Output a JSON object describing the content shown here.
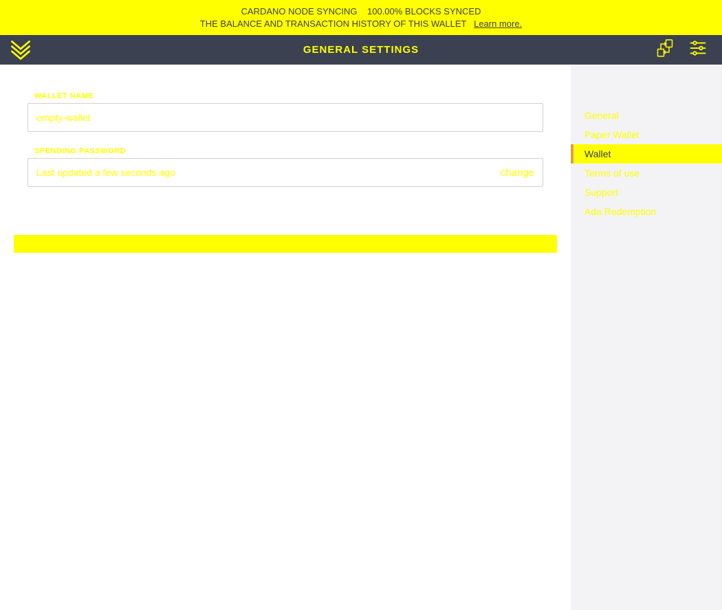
{
  "banner": {
    "line1_left": "CARDANO NODE SYNCING",
    "line1_right": "100.00% BLOCKS SYNCED",
    "line2_left": "THE BALANCE AND TRANSACTION HISTORY OF THIS WALLET",
    "learn_more": "Learn more."
  },
  "topbar": {
    "title": "GENERAL SETTINGS"
  },
  "form": {
    "wallet_name_label": "WALLET NAME",
    "wallet_name_value": "empty-wallet",
    "password_label": "SPENDING PASSWORD",
    "password_info": "Last updated a few seconds ago",
    "change": "change"
  },
  "sidebar": {
    "items": [
      {
        "label": "General",
        "active": false
      },
      {
        "label": "Paper Wallet",
        "active": false
      },
      {
        "label": "Wallet",
        "active": true
      },
      {
        "label": "Terms of use",
        "active": false
      },
      {
        "label": "Support",
        "active": false
      },
      {
        "label": "Ada Redemption",
        "active": false
      }
    ]
  }
}
